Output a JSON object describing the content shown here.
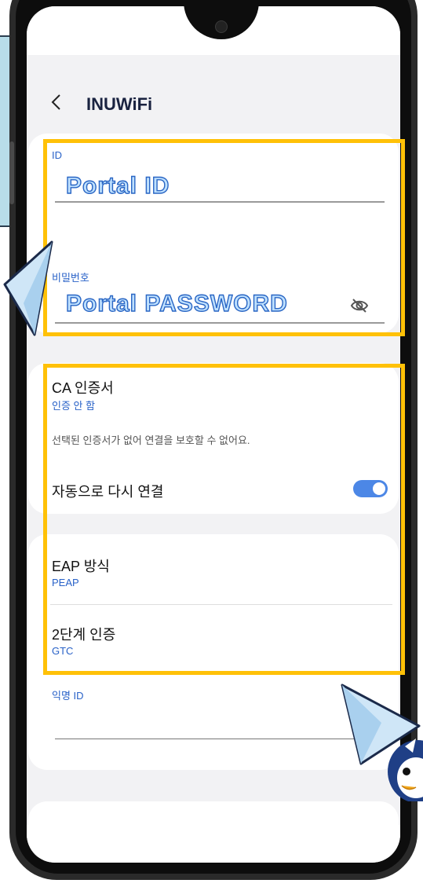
{
  "header": {
    "back_glyph": "<",
    "title": "INUWiFi"
  },
  "id_section": {
    "label": "ID",
    "value": "Portal ID"
  },
  "password_section": {
    "label": "비밀번호",
    "value": "Portal PASSWORD",
    "visibility_icon": "eye-off-icon"
  },
  "ca_certificate": {
    "title": "CA 인증서",
    "value": "인증 안 함",
    "hint": "선택된 인증서가 없어 연결을 보호할 수 없어요."
  },
  "auto_reconnect": {
    "title": "자동으로 다시 연결",
    "enabled": true
  },
  "eap_method": {
    "title": "EAP 방식",
    "value": "PEAP"
  },
  "phase2_auth": {
    "title": "2단계 인증",
    "value": "GTC"
  },
  "anonymous_id": {
    "label": "익명 ID",
    "value": ""
  },
  "colors": {
    "accent": "#2962c8",
    "highlight": "#ffc107",
    "toggle_on": "#4c87e6"
  }
}
